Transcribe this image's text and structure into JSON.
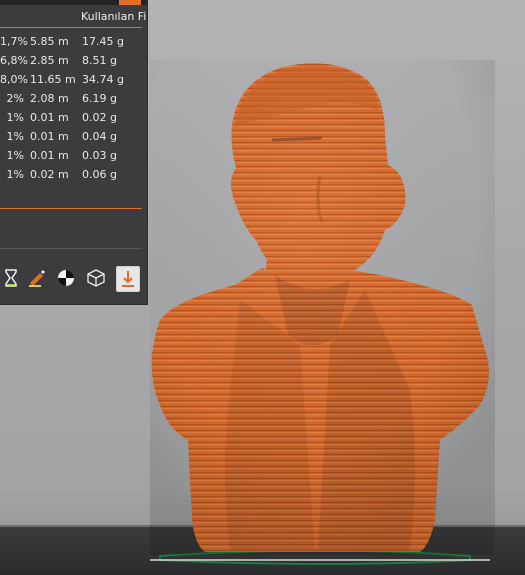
{
  "panel": {
    "header": "Kullanılan Filament",
    "rows": [
      {
        "pct": "1,7%",
        "length": "5.85 m",
        "weight": "17.45 g"
      },
      {
        "pct": "6,8%",
        "length": "2.85 m",
        "weight": "8.51 g"
      },
      {
        "pct": "8,0%",
        "length": "11.65 m",
        "weight": "34.74 g"
      },
      {
        "pct": "2%",
        "length": "2.08 m",
        "weight": "6.19 g"
      },
      {
        "pct": "1%",
        "length": "0.01 m",
        "weight": "0.02 g"
      },
      {
        "pct": "1%",
        "length": "0.01 m",
        "weight": "0.04 g"
      },
      {
        "pct": "1%",
        "length": "0.01 m",
        "weight": "0.03 g"
      },
      {
        "pct": "1%",
        "length": "0.02 m",
        "weight": "0.06 g"
      }
    ],
    "toolbar": [
      {
        "icon": "hourglass-icon"
      },
      {
        "icon": "paint-brush-icon"
      },
      {
        "icon": "contrast-circle-icon"
      },
      {
        "icon": "cube-icon"
      },
      {
        "icon": "export-download-icon"
      }
    ]
  },
  "model": {
    "name": "bust",
    "color": "#d8692b",
    "stripe_color": "#b8531d"
  },
  "colors": {
    "accent": "#e06d2a",
    "panel_bg": "#3c3c3f",
    "build_plate_outline": "#1f7a3b"
  }
}
